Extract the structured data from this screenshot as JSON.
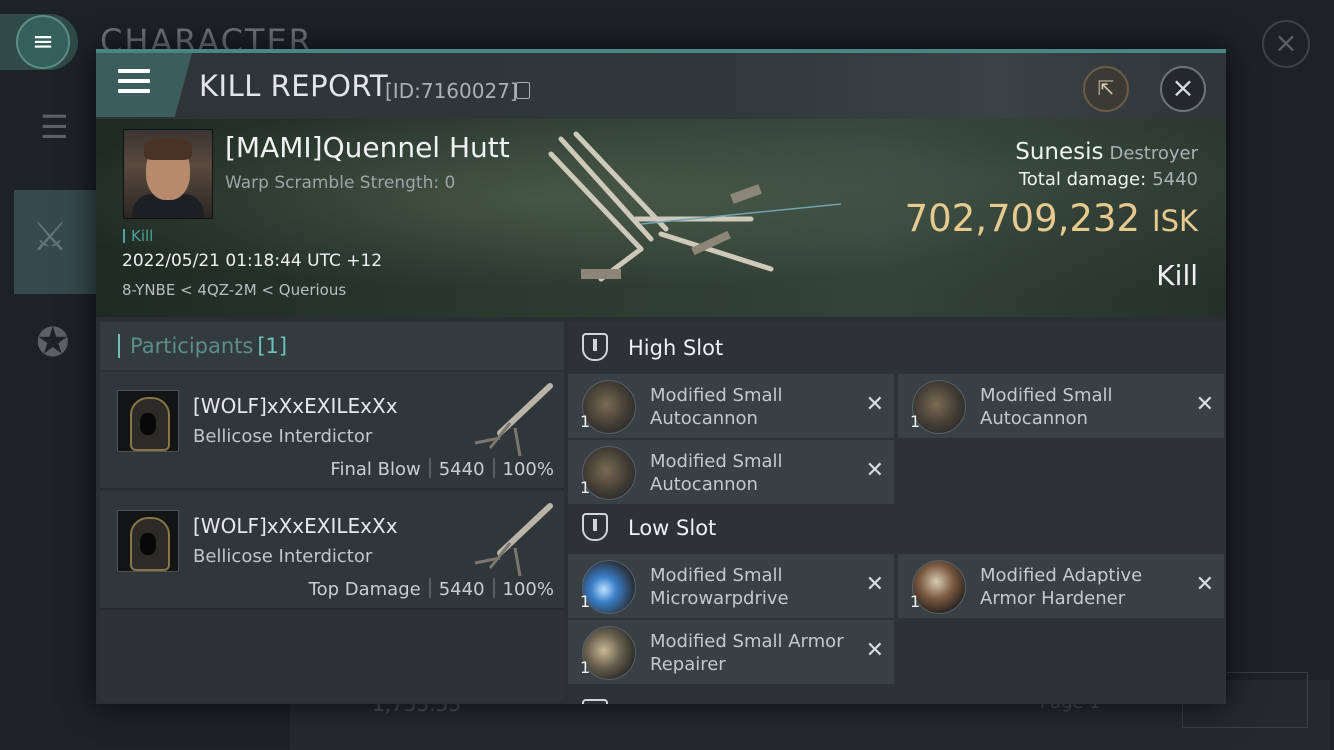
{
  "background": {
    "title": "CHARACTER",
    "balance": "1,755.55",
    "page": "Page 1"
  },
  "header": {
    "title": "KILL REPORT",
    "id": "[ID:7160027]",
    "menu_icon": "hamburger-icon",
    "share_icon": "external-link-icon",
    "close_icon": "close-icon"
  },
  "victim": {
    "name": "[MAMI]Quennel Hutt",
    "warp_scramble": "Warp Scramble Strength: 0",
    "kill_tag": "Kill",
    "timestamp": "2022/05/21 01:18:44 UTC +12",
    "location": "8-YNBE < 4QZ-2M < Querious",
    "ship": "Sunesis",
    "ship_class": "Destroyer",
    "total_damage_label": "Total damage:",
    "total_damage": "5440",
    "isk_value": "702,709,232",
    "isk_unit": "ISK",
    "result": "Kill"
  },
  "participants": {
    "label": "Participants",
    "count": "[1]",
    "items": [
      {
        "name": "[WOLF]xXxEXILExXx",
        "ship": "Bellicose Interdictor",
        "role": "Final Blow",
        "damage": "5440",
        "percent": "100%"
      },
      {
        "name": "[WOLF]xXxEXILExXx",
        "ship": "Bellicose Interdictor",
        "role": "Top Damage",
        "damage": "5440",
        "percent": "100%"
      }
    ]
  },
  "fittings": {
    "high_slot": {
      "title": "High Slot",
      "modules": [
        {
          "qty": "1",
          "name": "Modified Small Autocannon"
        },
        {
          "qty": "1",
          "name": "Modified Small Autocannon"
        },
        {
          "qty": "1",
          "name": "Modified Small Autocannon"
        }
      ]
    },
    "low_slot": {
      "title": "Low Slot",
      "modules": [
        {
          "qty": "1",
          "name": "Modified Small Microwarpdrive"
        },
        {
          "qty": "1",
          "name": "Modified Adaptive Armor Hardener"
        },
        {
          "qty": "1",
          "name": "Modified Small Armor Repairer"
        }
      ]
    },
    "remove_glyph": "✕"
  },
  "colors": {
    "accent": "#4a8784",
    "isk": "#e8c98e",
    "kill_tag": "#49a39b"
  }
}
